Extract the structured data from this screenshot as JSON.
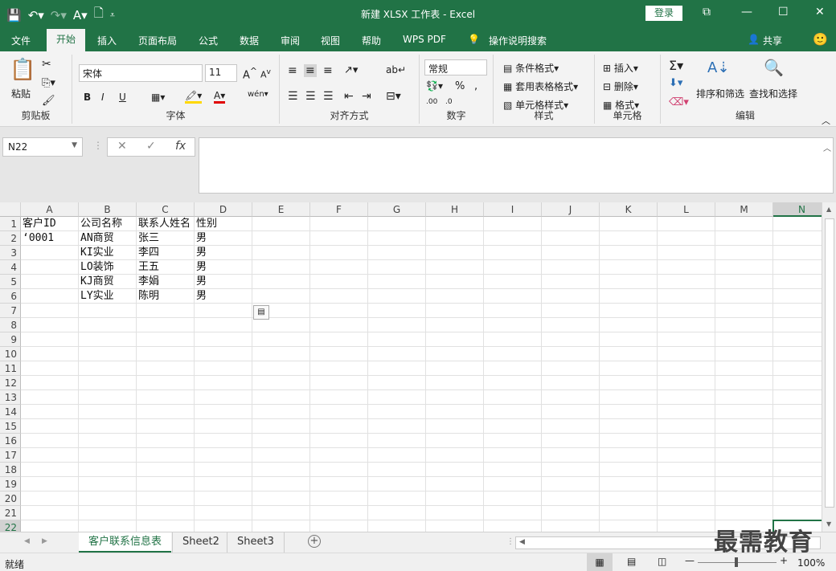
{
  "window": {
    "title": "新建 XLSX 工作表  -  Excel",
    "login": "登录"
  },
  "menu": {
    "tabs": [
      "文件",
      "开始",
      "插入",
      "页面布局",
      "公式",
      "数据",
      "审阅",
      "视图",
      "帮助",
      "WPS PDF",
      "操作说明搜索"
    ],
    "share": "共享"
  },
  "ribbon": {
    "clipboard": {
      "label": "剪贴板",
      "paste": "粘贴"
    },
    "font": {
      "label": "字体",
      "name": "宋体",
      "size": "11",
      "bold": "B",
      "italic": "I",
      "underline": "U"
    },
    "alignment": {
      "label": "对齐方式"
    },
    "number": {
      "label": "数字",
      "format": "常规"
    },
    "styles": {
      "label": "样式",
      "conditional": "条件格式",
      "table": "套用表格格式",
      "cell": "单元格样式"
    },
    "cells": {
      "label": "单元格",
      "insert": "插入",
      "delete": "删除",
      "format": "格式"
    },
    "editing": {
      "label": "编辑",
      "sort": "排序和筛选",
      "find": "查找和选择"
    }
  },
  "formula": {
    "namebox": "N22",
    "value": ""
  },
  "sheet": {
    "columns": [
      "A",
      "B",
      "C",
      "D",
      "E",
      "F",
      "G",
      "H",
      "I",
      "J",
      "K",
      "L",
      "M",
      "N"
    ],
    "rows": [
      "1",
      "2",
      "3",
      "4",
      "5",
      "6",
      "7",
      "8",
      "9",
      "10",
      "11",
      "12",
      "13",
      "14",
      "15",
      "16",
      "17",
      "18",
      "19",
      "20",
      "21",
      "22"
    ],
    "cells": [
      [
        "客户ID",
        "公司名称",
        "联系人姓名",
        "性别"
      ],
      [
        "‘0001",
        "AN商贸",
        "张三",
        "男"
      ],
      [
        "",
        "KI实业",
        "李四",
        "男"
      ],
      [
        "",
        "LO装饰",
        "王五",
        "男"
      ],
      [
        "",
        "KJ商贸",
        "李娟",
        "男"
      ],
      [
        "",
        "LY实业",
        "陈明",
        "男"
      ]
    ]
  },
  "tabs": {
    "sheets": [
      "客户联系信息表",
      "Sheet2",
      "Sheet3"
    ],
    "active": "客户联系信息表"
  },
  "status": {
    "ready": "就绪",
    "zoom": "100%"
  },
  "watermark": "最需教育",
  "colors": {
    "accent": "#217346"
  }
}
